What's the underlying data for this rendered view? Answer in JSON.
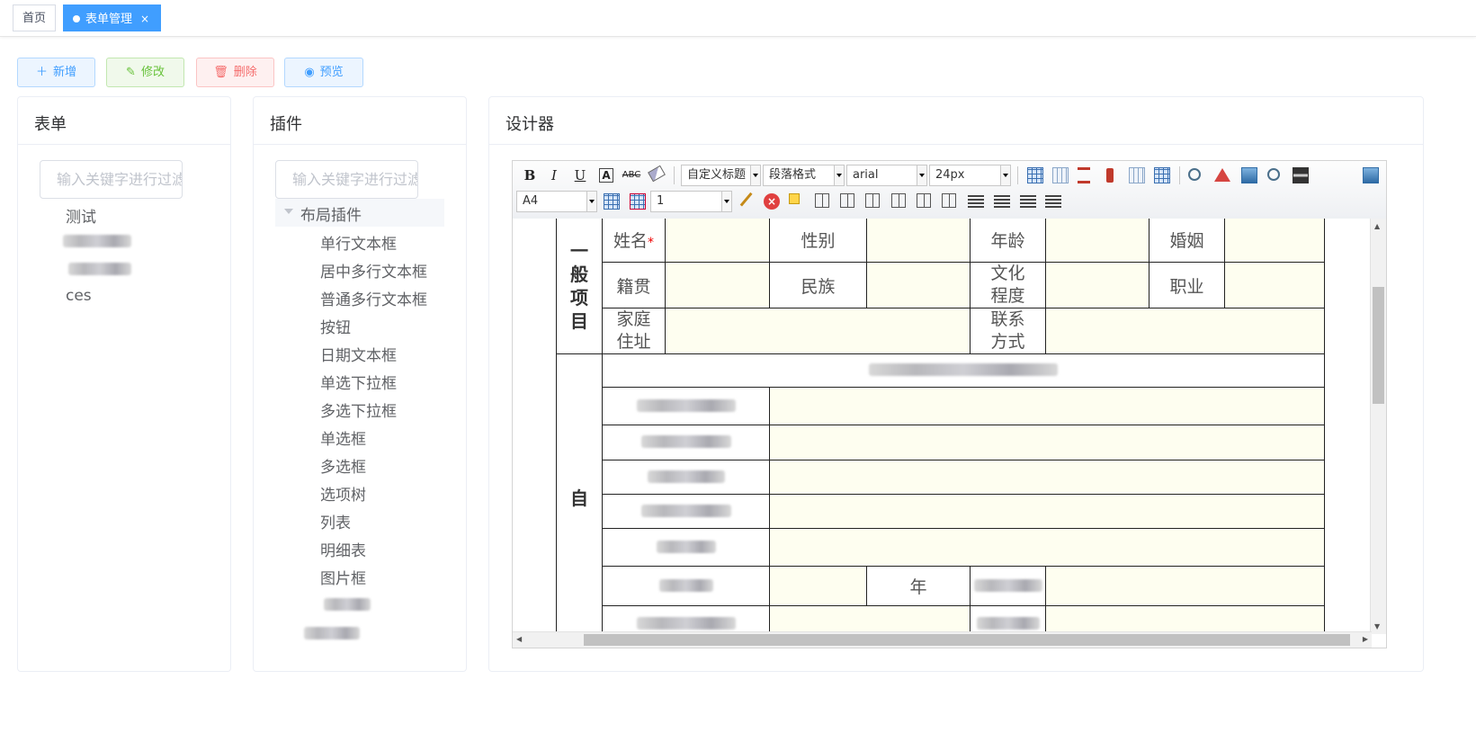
{
  "tabs": {
    "home": "首页",
    "active": "表单管理",
    "close": "×"
  },
  "actions": {
    "add": "新增",
    "edit": "修改",
    "delete": "删除",
    "preview": "预览"
  },
  "icons": {
    "add": "＋",
    "edit": "✎",
    "delete": "🗑",
    "preview": "◉"
  },
  "form_panel": {
    "title": "表单",
    "search_placeholder": "输入关键字进行过滤",
    "items": [
      "测试",
      "ces"
    ]
  },
  "plugin_panel": {
    "title": "插件",
    "search_placeholder": "输入关键字进行过滤",
    "group": "布局插件",
    "items": [
      "单行文本框",
      "居中多行文本框",
      "普通多行文本框",
      "按钮",
      "日期文本框",
      "单选下拉框",
      "多选下拉框",
      "单选框",
      "多选框",
      "选项树",
      "列表",
      "明细表",
      "图片框"
    ]
  },
  "designer": {
    "title": "设计器",
    "toolbar": {
      "bold": "B",
      "italic": "I",
      "underline": "U",
      "fontcolor": "A",
      "strike": "ABC",
      "title_select": "自定义标题",
      "paragraph_select": "段落格式",
      "font_select": "arial",
      "size_select": "24px",
      "page_select": "A4",
      "row_select": "1"
    },
    "form": {
      "section1": "一般项目",
      "section2": "自",
      "name": "姓名",
      "required": "*",
      "gender": "性别",
      "age": "年龄",
      "marriage": "婚姻",
      "native": "籍贯",
      "ethnic": "民族",
      "education": "文化程度",
      "job": "职业",
      "address": "家庭住址",
      "contact": "联系方式",
      "year": "年"
    }
  }
}
